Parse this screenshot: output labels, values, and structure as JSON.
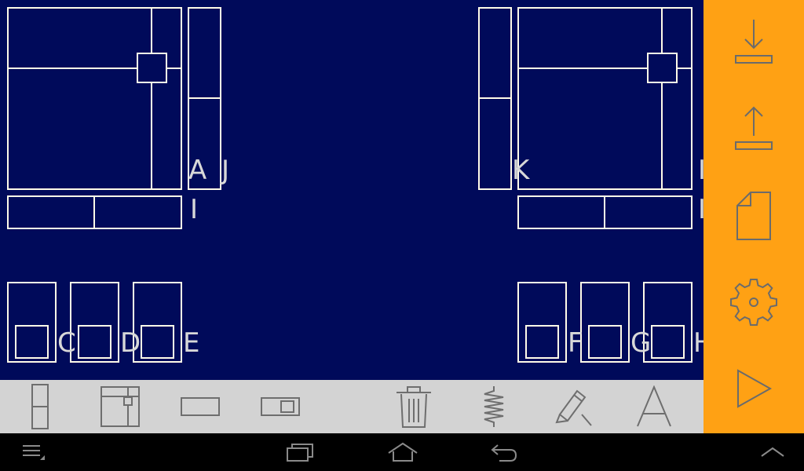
{
  "app": {
    "colors": {
      "canvas_bg": "#000a5a",
      "frame_line": "#fffbe8",
      "label_text": "#d8d8d8",
      "toolbar_bg": "#d3d3d3",
      "side_panel_bg": "#ffa114",
      "nav_bg": "#000000"
    }
  },
  "canvas": {
    "labels": {
      "A": "A",
      "J": "J",
      "I": "I",
      "K": "K",
      "C": "C",
      "D": "D",
      "E": "E",
      "F": "F",
      "G": "G",
      "H": "H"
    }
  },
  "toolbar": {
    "tools": [
      {
        "icon": "vertical-split-panel-icon"
      },
      {
        "icon": "window-frame-icon"
      },
      {
        "icon": "horizontal-panel-icon"
      },
      {
        "icon": "panel-with-handle-icon"
      },
      {
        "icon": "trash-icon"
      },
      {
        "icon": "spring-icon"
      },
      {
        "icon": "pencil-icon"
      },
      {
        "icon": "compass-icon"
      }
    ]
  },
  "side_panel": {
    "buttons": [
      {
        "icon": "download-icon"
      },
      {
        "icon": "upload-icon"
      },
      {
        "icon": "new-document-icon"
      },
      {
        "icon": "settings-gear-icon"
      },
      {
        "icon": "play-icon"
      }
    ]
  },
  "navbar": {
    "buttons": [
      {
        "icon": "menu-icon"
      },
      {
        "icon": "recent-apps-icon"
      },
      {
        "icon": "home-icon"
      },
      {
        "icon": "back-icon"
      },
      {
        "icon": "chevron-up-icon"
      }
    ]
  }
}
